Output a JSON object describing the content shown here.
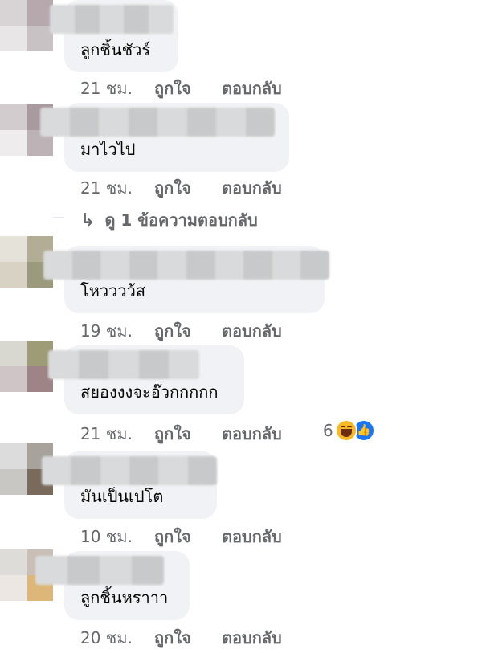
{
  "comments": [
    {
      "text": "ลูกชิ้นชัวร์",
      "time": "21 ชม.",
      "like": "ถูกใจ",
      "reply": "ตอบกลับ"
    },
    {
      "text": "มาไวไป",
      "time": "21 ชม.",
      "like": "ถูกใจ",
      "reply": "ตอบกลับ"
    },
    {
      "text": "โหวววว้ส",
      "time": "19 ชม.",
      "like": "ถูกใจ",
      "reply": "ตอบกลับ"
    },
    {
      "text": "สยองงงจะอ๊วกกกกก",
      "time": "21 ชม.",
      "like": "ถูกใจ",
      "reply": "ตอบกลับ",
      "reaction_count": "6"
    },
    {
      "text": "มันเป็นเปโต",
      "time": "10 ชม.",
      "like": "ถูกใจ",
      "reply": "ตอบกลับ"
    },
    {
      "text": "ลูกชิ้นหราาา",
      "time": "20 ชม.",
      "like": "ถูกใจ",
      "reply": "ตอบกลับ"
    }
  ],
  "view_replies": "ดู 1 ข้อความตอบกลับ",
  "icons": {
    "reply_arrow": "reply-arrow-icon",
    "haha": "haha-reaction-icon",
    "like": "like-reaction-icon"
  },
  "colors": {
    "bubble": "#f0f2f5",
    "meta_text": "#65676b",
    "like_blue": "#1877f2",
    "haha_yellow": "#f7b928"
  }
}
